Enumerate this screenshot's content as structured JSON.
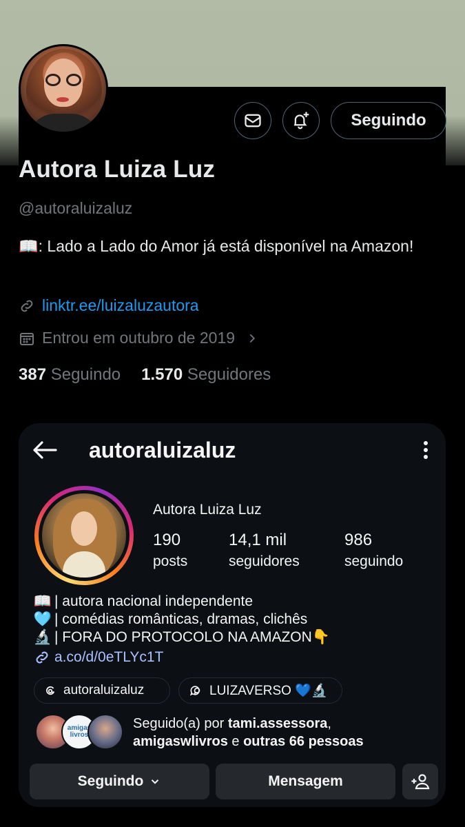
{
  "twitter": {
    "display_name": "Autora Luiza Luz",
    "handle": "@autoraluizaluz",
    "bio": "📖: Lado a Lado do Amor já está disponível na Amazon!",
    "link": "linktr.ee/luizaluzautora",
    "joined": "Entrou em outubro de 2019",
    "following_count": "387",
    "following_label": "Seguindo",
    "followers_count": "1.570",
    "followers_label": "Seguidores",
    "follow_button_label": "Seguindo",
    "icons": [
      "mail-icon",
      "bell-plus-icon",
      "link-icon",
      "calendar-icon",
      "chevron-right-icon"
    ]
  },
  "instagram": {
    "username": "autoraluizaluz",
    "full_name": "Autora Luiza Luz",
    "stats": {
      "posts_num": "190",
      "posts_label": "posts",
      "followers_num": "14,1 mil",
      "followers_label": "seguidores",
      "following_num": "986",
      "following_label": "seguindo"
    },
    "bio_lines": [
      {
        "emoji": "📖",
        "text": "| autora nacional independente"
      },
      {
        "emoji": "🩵",
        "text": "| comédias românticas, dramas, clichês"
      },
      {
        "emoji": "🔬",
        "text": "| FORA DO PROTOCOLO NA AMAZON👇"
      }
    ],
    "bio_link": "a.co/d/0eTLYc1T",
    "chips": {
      "threads_label": "autoraluizaluz",
      "highlight_label": "LUIZAVERSO 💙🔬"
    },
    "followed_by": {
      "prefix": "Seguido(a) por ",
      "user1": "tami.assessora",
      "sep": ",",
      "user2": "amigaswlivros",
      "middle": " e ",
      "others": "outras 66 pessoas",
      "mini_avatar_text": "amigas livros"
    },
    "buttons": {
      "following": "Seguindo",
      "message": "Mensagem"
    },
    "icons": [
      "back-arrow-icon",
      "more-vertical-icon",
      "link-icon",
      "threads-icon",
      "chevron-down-icon",
      "add-person-icon"
    ]
  },
  "colors": {
    "twitter_link": "#1d9bf0",
    "twitter_muted": "#71767b",
    "instagram_card_bg": "#0c1014",
    "instagram_button_bg": "#25292e",
    "instagram_link": "#a8c1ff",
    "top_bg": "#b1bba5"
  }
}
